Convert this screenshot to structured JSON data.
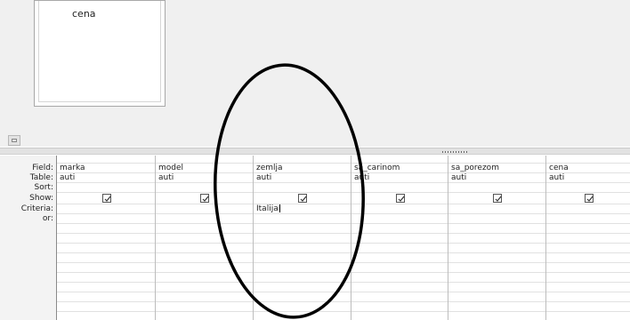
{
  "table_box": {
    "fields": [
      "cena"
    ]
  },
  "grid": {
    "row_labels": [
      "Field:",
      "Table:",
      "Sort:",
      "Show:",
      "Criteria:",
      "or:"
    ],
    "columns": [
      {
        "field": "marka",
        "table": "auti",
        "sort": "",
        "show": true,
        "criteria": "",
        "or": ""
      },
      {
        "field": "model",
        "table": "auti",
        "sort": "",
        "show": true,
        "criteria": "",
        "or": ""
      },
      {
        "field": "zemlja",
        "table": "auti",
        "sort": "",
        "show": true,
        "criteria": "Italija",
        "or": ""
      },
      {
        "field": "sa_carinom",
        "table": "auti",
        "sort": "",
        "show": true,
        "criteria": "",
        "or": ""
      },
      {
        "field": "sa_porezom",
        "table": "auti",
        "sort": "",
        "show": true,
        "criteria": "",
        "or": ""
      },
      {
        "field": "cena",
        "table": "auti",
        "sort": "",
        "show": true,
        "criteria": "",
        "or": ""
      }
    ]
  },
  "colors": {
    "background_top": "#f0f0f0",
    "grid_line": "#bdbdbd",
    "annotation": "#000000"
  }
}
